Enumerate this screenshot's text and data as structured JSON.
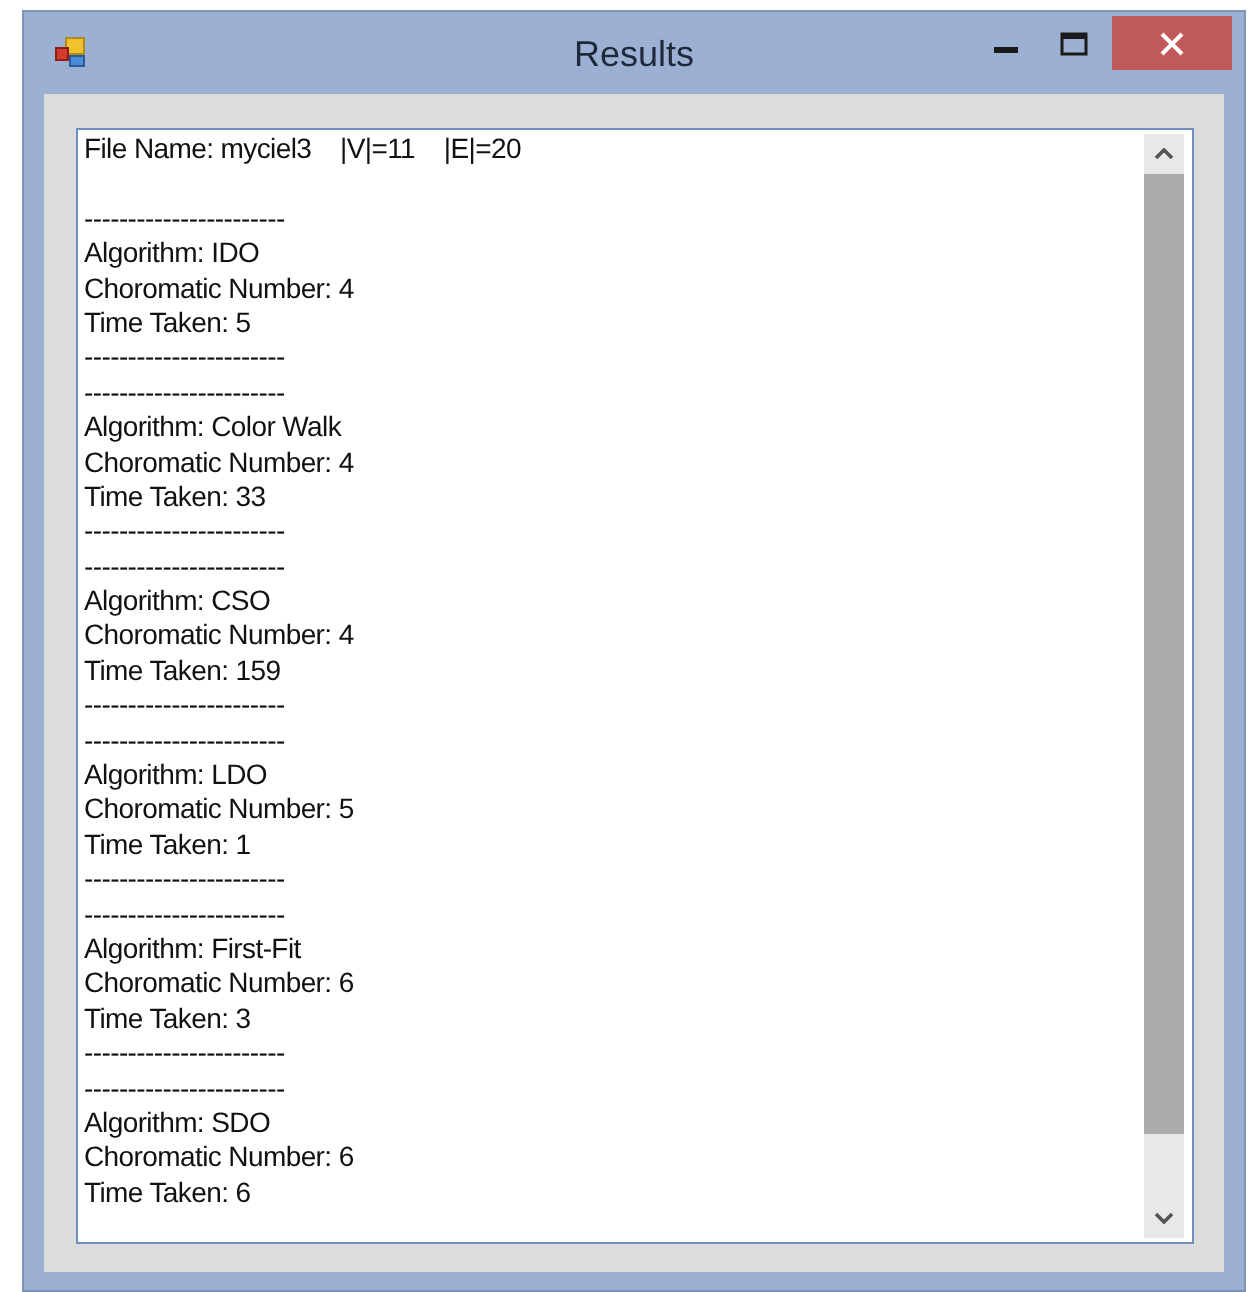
{
  "window": {
    "title": "Results"
  },
  "text_box": {
    "header": "File Name: myciel3    |V|=11    |E|=20",
    "sections": [
      {
        "top": "-----------------------",
        "lines": [
          "Algorithm: IDO",
          "Choromatic Number: 4",
          "Time Taken: 5"
        ],
        "bottom": "-----------------------"
      },
      {
        "top": "-----------------------",
        "lines": [
          "Algorithm: Color Walk",
          "Choromatic Number: 4",
          "Time Taken: 33"
        ],
        "bottom": "-----------------------"
      },
      {
        "top": "-----------------------",
        "lines": [
          "Algorithm: CSO",
          "Choromatic Number: 4",
          "Time Taken: 159"
        ],
        "bottom": "-----------------------"
      },
      {
        "top": "-----------------------",
        "lines": [
          "Algorithm: LDO",
          "Choromatic Number: 5",
          "Time Taken: 1"
        ],
        "bottom": "-----------------------"
      },
      {
        "top": "-----------------------",
        "lines": [
          "Algorithm: First-Fit",
          "Choromatic Number: 6",
          "Time Taken: 3"
        ],
        "bottom": "-----------------------"
      },
      {
        "top": "-----------------------",
        "lines": [
          "Algorithm: SDO",
          "Choromatic Number: 6",
          "Time Taken: 6"
        ]
      }
    ]
  }
}
